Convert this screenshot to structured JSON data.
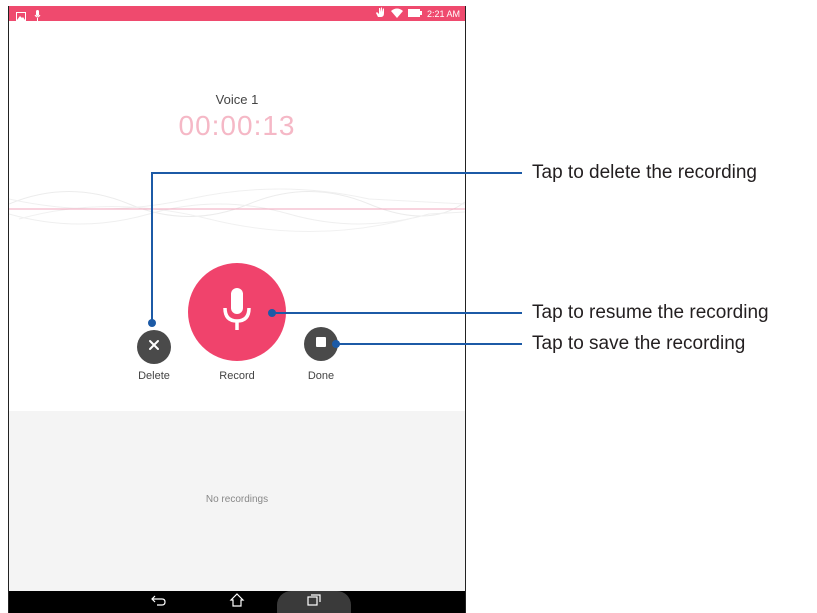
{
  "status_bar": {
    "time": "2:21 AM",
    "icons": [
      "gallery-icon",
      "microphone-icon",
      "hand-icon",
      "wifi-icon",
      "battery-icon"
    ],
    "color": "#ef4a6e"
  },
  "recorder": {
    "recording_name": "Voice 1",
    "elapsed_time": "00:00:13",
    "timer_color": "#f5b8c6"
  },
  "controls": {
    "delete_label": "Delete",
    "record_label": "Record",
    "done_label": "Done",
    "record_color": "#f0436c",
    "secondary_color": "#4a4a4a"
  },
  "recordings": {
    "empty_text": "No recordings"
  },
  "nav_bar": {
    "icons": [
      "back-icon",
      "home-icon",
      "recent-apps-icon"
    ]
  },
  "callouts": {
    "delete": "Tap to delete the recording",
    "resume": "Tap to resume the recording",
    "save": "Tap to save the recording",
    "line_color": "#1c5aa6"
  }
}
